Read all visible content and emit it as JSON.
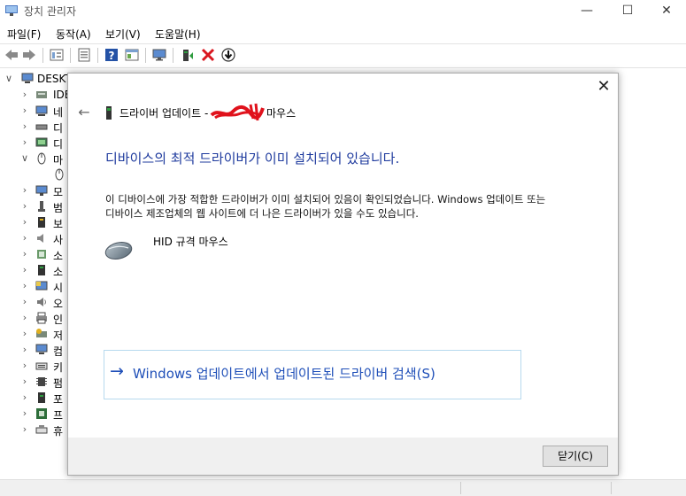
{
  "app": {
    "title": "장치 관리자",
    "controls": {
      "minimize": "—",
      "maximize": "☐",
      "close": "✕"
    }
  },
  "menu": {
    "items": [
      "파일(F)",
      "동작(A)",
      "보기(V)",
      "도움말(H)"
    ]
  },
  "toolbar": {
    "icons": [
      "back-arrow-icon",
      "forward-arrow-icon",
      "properties-icon",
      "document-icon",
      "help-icon",
      "view-icon",
      "monitor-icon",
      "update-driver-icon",
      "uninstall-icon",
      "download-icon"
    ]
  },
  "tree": {
    "root": "DESKT",
    "items": [
      {
        "label": "IDE"
      },
      {
        "label": "네"
      },
      {
        "label": "디"
      },
      {
        "label": "디"
      },
      {
        "label": "마"
      },
      {
        "label": ""
      },
      {
        "label": "모"
      },
      {
        "label": "범"
      },
      {
        "label": "보"
      },
      {
        "label": "사"
      },
      {
        "label": "소"
      },
      {
        "label": "소"
      },
      {
        "label": "시"
      },
      {
        "label": "오"
      },
      {
        "label": "인"
      },
      {
        "label": "저"
      },
      {
        "label": "컴"
      },
      {
        "label": "키"
      },
      {
        "label": "펌"
      },
      {
        "label": "포"
      },
      {
        "label": "프"
      },
      {
        "label": "휴"
      }
    ]
  },
  "dialog": {
    "title": "드라이버 업데이트 -",
    "title_suffix": "마우스",
    "heading": "디바이스의 최적 드라이버가 이미 설치되어 있습니다.",
    "body": "이 디바이스에 가장 적합한 드라이버가 이미 설치되어 있음이 확인되었습니다. Windows 업데이트 또는 디바이스 제조업체의 웹 사이트에 더 나은 드라이버가 있을 수도 있습니다.",
    "device_name": "HID 규격 마우스",
    "search_button": "Windows 업데이트에서 업데이트된 드라이버 검색(S)",
    "close_button": "닫기(C)",
    "close_icon": "✕",
    "back_icon": "←",
    "arrow_icon": "→"
  },
  "colors": {
    "heading_blue": "#1f3b9e",
    "link_blue": "#1f4fb8",
    "redaction_red": "#e0121c",
    "footer_gray": "#f0f0f0"
  }
}
